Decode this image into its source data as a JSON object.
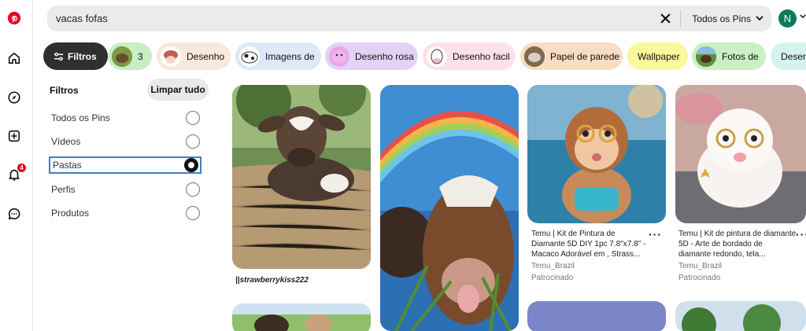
{
  "search": {
    "query": "vacas fofas",
    "scope": "Todos os Pins"
  },
  "user": {
    "initial": "N"
  },
  "chips": [
    {
      "label": "Filtros",
      "icon": "sliders-icon"
    },
    {
      "label": "3"
    },
    {
      "label": "Desenho"
    },
    {
      "label": "Imagens de"
    },
    {
      "label": "Desenho rosa"
    },
    {
      "label": "Desenho facil"
    },
    {
      "label": "Papel de parede"
    },
    {
      "label": "Wallpaper"
    },
    {
      "label": "Fotos de"
    },
    {
      "label": "Desen"
    }
  ],
  "filters": {
    "title": "Filtros",
    "clear": "Limpar tudo",
    "options": [
      "Todos os Pins",
      "Vídeos",
      "Pastas",
      "Perfis",
      "Produtos"
    ],
    "selected": "Pastas"
  },
  "pins": [
    {
      "caption": "||strawberrykiss222"
    },
    {
      "title": "Temu | Kit de Pintura de Diamante 5D DIY 1pc 7.8\"x7.8\" - Macaco Adorável em , Strass...",
      "source": "Temu_Brazil",
      "sponsored": "Patrocinado"
    },
    {
      "title": "Temu | Kit de pintura de diamante 5D - Arte de bordado de diamante redondo, tela...",
      "source": "Temu_Brazil",
      "sponsored": "Patrocinado"
    }
  ],
  "colors": {
    "brand": "#e60023",
    "filter_chip": "#2f2f2f",
    "selected_outline": "#3b80c6",
    "avatar": "#0a7a5a"
  }
}
